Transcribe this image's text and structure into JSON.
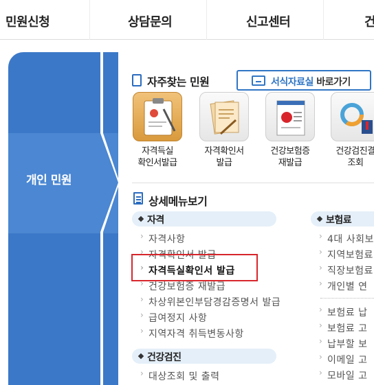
{
  "topnav": {
    "items": [
      "민원신청",
      "상담문의",
      "신고센터",
      "건"
    ]
  },
  "left_panel": {
    "label": "개인 민원"
  },
  "favorites": {
    "title": "자주찾는 민원",
    "forms_button": {
      "blue_text": "서식자료실",
      "dark_text": " 바로가기"
    },
    "quick_items": [
      {
        "line1": "자격득실",
        "line2": "확인서발급"
      },
      {
        "line1": "자격확인서",
        "line2": "발급"
      },
      {
        "line1": "건강보험증",
        "line2": "재발급"
      },
      {
        "line1": "건강검진결",
        "line2": "조회"
      }
    ]
  },
  "detail_menu": {
    "title": "상세메뉴보기",
    "groups": [
      {
        "name": "자격",
        "items": [
          "자격사항",
          "자격확인서 발급",
          "자격득실확인서 발급",
          "건강보험증 재발급",
          "차상위본인부담경감증명서 발급",
          "급여정지 사항",
          "지역자격 취득변동사항"
        ]
      },
      {
        "name": "건강검진",
        "items": [
          "대상조회 및 출력"
        ]
      },
      {
        "name": "보험료",
        "items": [
          "4대 사회보",
          "지역보험료",
          "직장보험료",
          "개인별 연",
          "보험료 납",
          "보험료 고",
          "납부할 보",
          "이메일 고",
          "모바일 고"
        ]
      }
    ]
  },
  "colors": {
    "panel_blue": "#3c78c8",
    "accent_blue": "#2f75c4",
    "highlight_red": "#d8252c",
    "group_bg": "#e4eff9"
  }
}
